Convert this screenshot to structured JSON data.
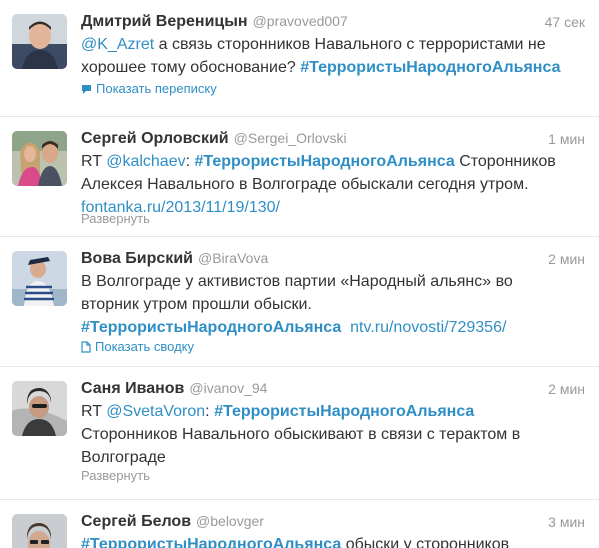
{
  "tweets": [
    {
      "name": "Дмитрий Вереницын",
      "handle": "@pravoved007",
      "time": "47 сек",
      "avatar_icon": "user-avatar-photo",
      "lines": [
        [
          {
            "t": "mention",
            "v": "@K_Azret"
          },
          {
            "t": "text",
            "v": " а связь сторонников Навального с террористами не"
          }
        ],
        [
          {
            "t": "text",
            "v": "хорошее тому обоснование? "
          },
          {
            "t": "hashtag",
            "v": "#ТеррористыНародногоАльянса"
          }
        ]
      ],
      "action": {
        "label": "Показать переписку",
        "icon": "conversation-bubble-icon"
      }
    },
    {
      "name": "Сергей Орловский",
      "handle": "@Sergei_Orlovski",
      "time": "1 мин",
      "avatar_icon": "user-avatar-photo",
      "lines": [
        [
          {
            "t": "text",
            "v": "RT "
          },
          {
            "t": "mention",
            "v": "@kalchaev"
          },
          {
            "t": "text",
            "v": ": "
          },
          {
            "t": "hashtag",
            "v": "#ТеррористыНародногоАльянса"
          },
          {
            "t": "text",
            "v": " Сторонников"
          }
        ],
        [
          {
            "t": "text",
            "v": "Алексея Навального в Волгограде обыскали сегодня утром."
          }
        ],
        [
          {
            "t": "link",
            "v": "fontanka.ru/2013/11/19/130/"
          }
        ]
      ],
      "action": {
        "label": "Развернуть",
        "icon": ""
      }
    },
    {
      "name": "Вова Бирский",
      "handle": "@BiraVova",
      "time": "2 мин",
      "avatar_icon": "user-avatar-photo",
      "lines": [
        [
          {
            "t": "text",
            "v": "В Волгограде у активистов партии «Народный альянс» во"
          }
        ],
        [
          {
            "t": "text",
            "v": "вторник утром прошли обыски."
          }
        ],
        [
          {
            "t": "hashtag",
            "v": "#ТеррористыНародногоАльянса"
          },
          {
            "t": "text",
            "v": "  "
          },
          {
            "t": "link",
            "v": "ntv.ru/novosti/729356/"
          }
        ]
      ],
      "action": {
        "label": "Показать сводку",
        "icon": "summary-document-icon"
      }
    },
    {
      "name": "Саня Иванов",
      "handle": "@ivanov_94",
      "time": "2 мин",
      "avatar_icon": "user-avatar-photo",
      "lines": [
        [
          {
            "t": "text",
            "v": "RT "
          },
          {
            "t": "mention",
            "v": "@SvetaVoron"
          },
          {
            "t": "text",
            "v": ": "
          },
          {
            "t": "hashtag",
            "v": "#ТеррористыНародногоАльянса"
          }
        ],
        [
          {
            "t": "text",
            "v": "Сторонников Навального обыскивают в связи с терактом в"
          }
        ],
        [
          {
            "t": "text",
            "v": "Волгограде"
          }
        ]
      ],
      "action": {
        "label": "Развернуть",
        "icon": ""
      }
    },
    {
      "name": "Сергей Белов",
      "handle": "@belovger",
      "time": "3 мин",
      "avatar_icon": "user-avatar-photo",
      "lines": [
        [
          {
            "t": "hashtag",
            "v": "#ТеррористыНародногоАльянса"
          },
          {
            "t": "text",
            "v": " обыски у сторонников"
          }
        ]
      ],
      "action": null
    }
  ],
  "colors": {
    "link": "#2f8fc5",
    "muted": "#999999",
    "text": "#333333",
    "divider": "#e8e8e8"
  }
}
